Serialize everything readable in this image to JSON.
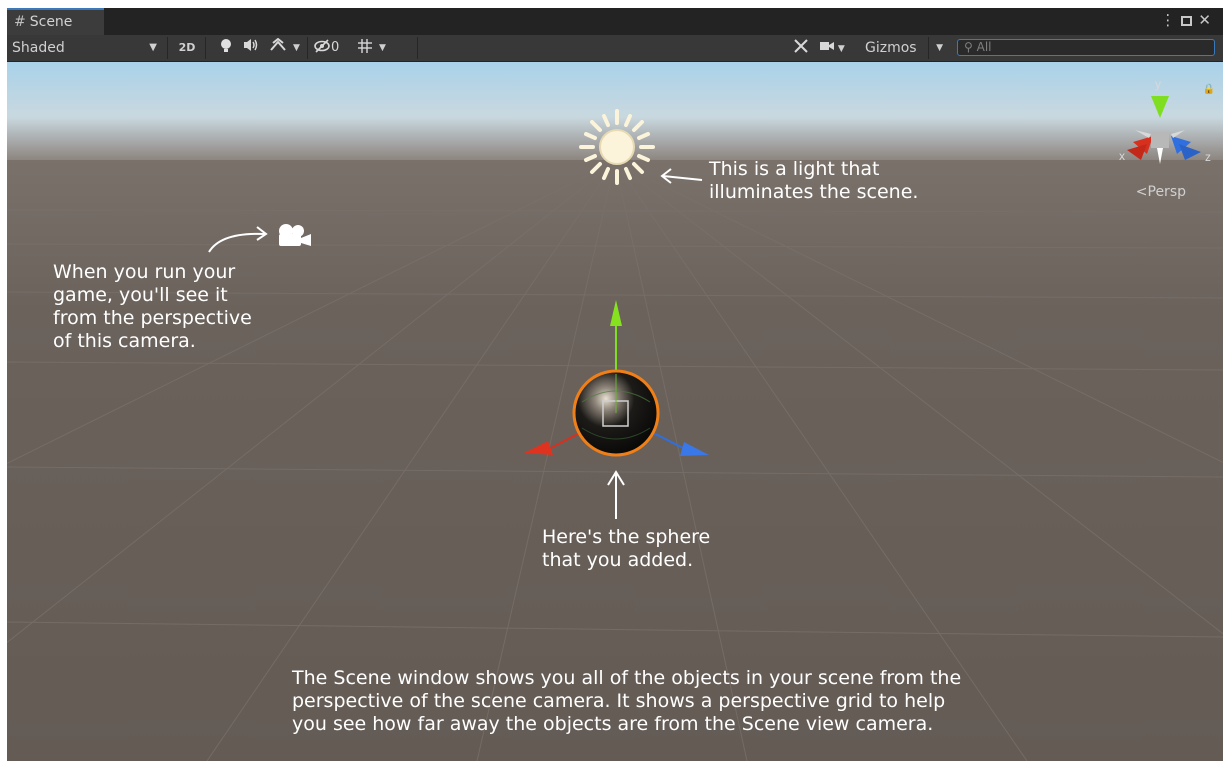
{
  "window": {
    "tab_title": "Scene",
    "tab_icon": "hash-icon",
    "controls": [
      "kebab-menu-icon",
      "maximize-icon",
      "close-icon"
    ]
  },
  "toolbar": {
    "draw_mode": "Shaded",
    "toggle_2d": "2D",
    "hidden_count": "0",
    "gizmos_label": "Gizmos",
    "search_placeholder": "All"
  },
  "viewport": {
    "projection_label": "Persp",
    "axis_labels": {
      "x": "x",
      "y": "y",
      "z": "z"
    },
    "annotations": {
      "light": "This is a light that\nilluminates the scene.",
      "camera": "When you run your\ngame, you'll see it\nfrom the perspective\nof this camera.",
      "sphere": "Here's the sphere\nthat you added.",
      "scene": "The Scene window shows you all of the objects in your scene from the\nperspective of the scene camera. It shows a perspective grid to help\nyou see how far away the objects are from the Scene view camera."
    }
  },
  "colors": {
    "sky_top": "#a8cfe6",
    "sky_horizon": "#7f7670",
    "ground": "#675e58",
    "selection_outline": "#f07f18",
    "axis_x": "#d8301f",
    "axis_y": "#7fde1f",
    "axis_z": "#2f6fe0",
    "accent_blue": "#3a79bb"
  }
}
